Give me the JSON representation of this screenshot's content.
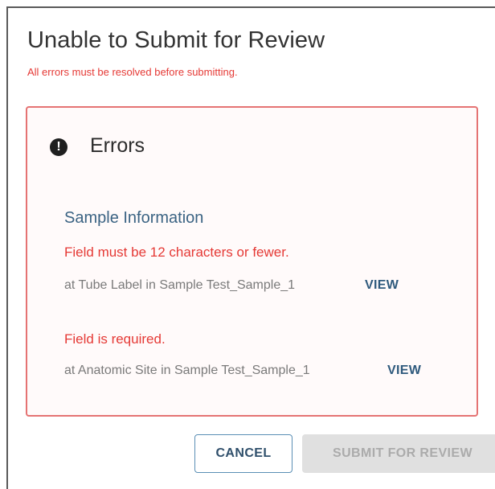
{
  "dialog": {
    "title": "Unable to Submit for Review",
    "subtitle": "All errors must be resolved before submitting."
  },
  "errors_panel": {
    "icon": "exclamation-circle-icon",
    "heading": "Errors",
    "section_title": "Sample Information",
    "items": [
      {
        "message": "Field must be 12 characters or fewer.",
        "location": "at Tube Label in Sample Test_Sample_1",
        "link": "VIEW"
      },
      {
        "message": "Field is required.",
        "location": "at Anatomic Site in Sample Test_Sample_1",
        "link": "VIEW"
      }
    ]
  },
  "buttons": {
    "cancel": "CANCEL",
    "submit": "SUBMIT FOR REVIEW"
  },
  "colors": {
    "error_red": "#e53935",
    "error_border": "#e57373",
    "link_blue": "#2f5a7d",
    "section_blue": "#3b6383",
    "disabled_bg": "#e0e0e0"
  }
}
